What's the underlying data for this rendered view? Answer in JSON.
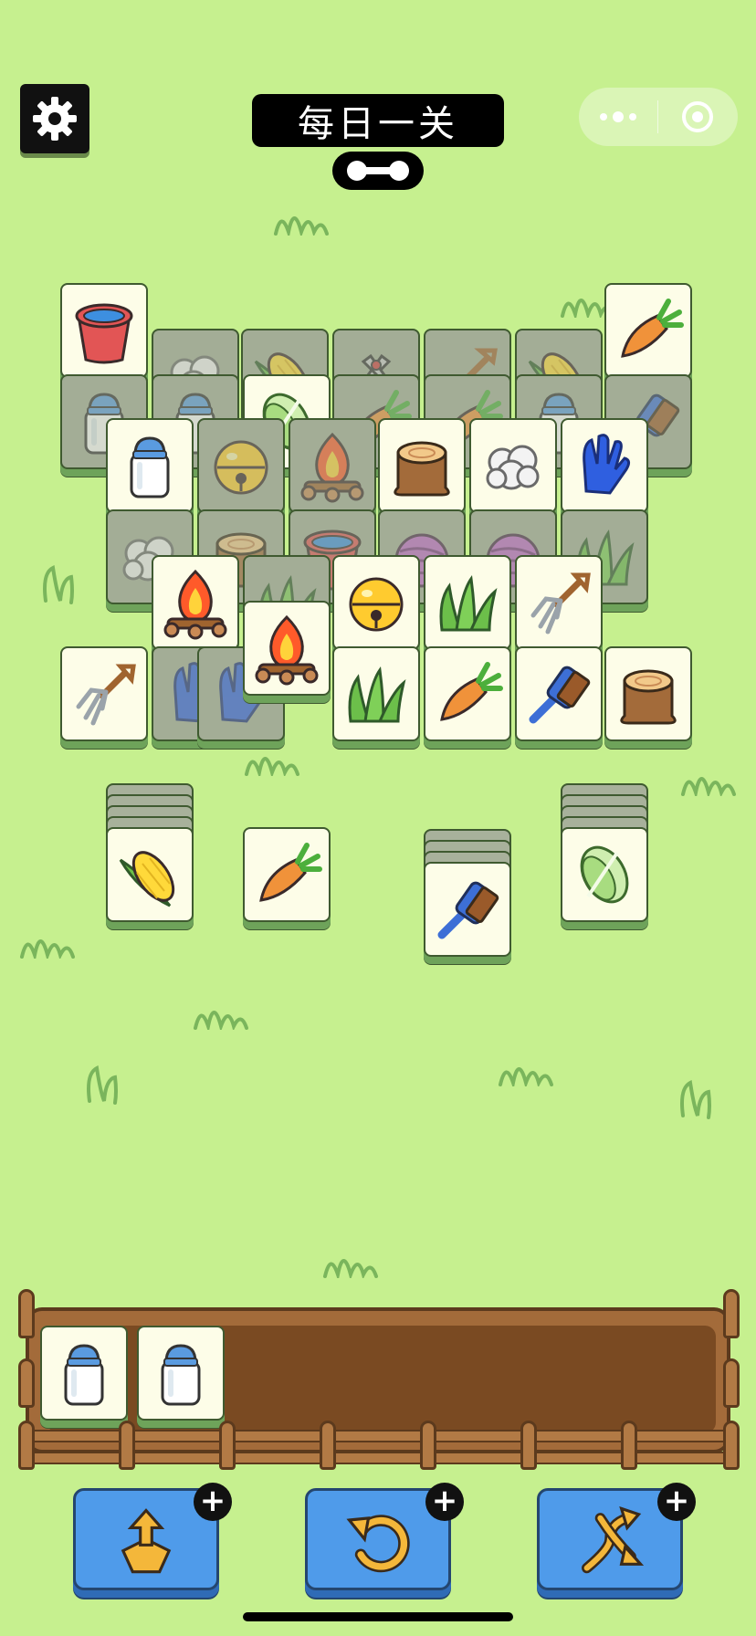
{
  "header": {
    "title": "每日一关",
    "settings_icon": "gear-icon",
    "menu_icon": "more-dots-icon",
    "close_icon": "target-circle-icon"
  },
  "colors": {
    "background": "#c6f08f",
    "tile_face": "#fdfde8",
    "tile_covered": "#a3ad96",
    "tray_wood": "#a36b3a",
    "button_blue": "#4f9bea"
  },
  "board": {
    "tiles": [
      {
        "item": "bucket",
        "state": "free"
      },
      {
        "item": "carrot",
        "state": "free"
      },
      {
        "item": "wool",
        "state": "covered"
      },
      {
        "item": "corn",
        "state": "covered"
      },
      {
        "item": "shears",
        "state": "covered"
      },
      {
        "item": "shovel",
        "state": "covered"
      },
      {
        "item": "corn",
        "state": "covered"
      },
      {
        "item": "milk-jar",
        "state": "covered"
      },
      {
        "item": "milk-jar",
        "state": "covered"
      },
      {
        "item": "carrot",
        "state": "covered"
      },
      {
        "item": "carrot",
        "state": "covered"
      },
      {
        "item": "milk-jar",
        "state": "covered"
      },
      {
        "item": "brush",
        "state": "covered"
      },
      {
        "item": "cabbage",
        "state": "free"
      },
      {
        "item": "milk-jar",
        "state": "free"
      },
      {
        "item": "bell",
        "state": "covered"
      },
      {
        "item": "campfire",
        "state": "covered"
      },
      {
        "item": "stump",
        "state": "free"
      },
      {
        "item": "wool",
        "state": "free"
      },
      {
        "item": "glove",
        "state": "free"
      },
      {
        "item": "wool",
        "state": "covered"
      },
      {
        "item": "stump",
        "state": "covered"
      },
      {
        "item": "bucket",
        "state": "covered"
      },
      {
        "item": "yarn",
        "state": "covered"
      },
      {
        "item": "yarn",
        "state": "covered"
      },
      {
        "item": "grass",
        "state": "covered"
      },
      {
        "item": "campfire",
        "state": "free"
      },
      {
        "item": "grass",
        "state": "covered"
      },
      {
        "item": "bell",
        "state": "free"
      },
      {
        "item": "grass",
        "state": "free"
      },
      {
        "item": "pitchfork",
        "state": "free"
      },
      {
        "item": "pitchfork",
        "state": "free"
      },
      {
        "item": "glove",
        "state": "covered"
      },
      {
        "item": "glove",
        "state": "covered"
      },
      {
        "item": "campfire",
        "state": "free"
      },
      {
        "item": "grass",
        "state": "free"
      },
      {
        "item": "carrot",
        "state": "free"
      },
      {
        "item": "brush",
        "state": "free"
      },
      {
        "item": "stump",
        "state": "free"
      }
    ],
    "stacks": [
      {
        "top_item": "corn",
        "hidden_count": 4
      },
      {
        "top_item": "carrot",
        "hidden_count": 0
      },
      {
        "top_item": "brush",
        "hidden_count": 3
      },
      {
        "top_item": "cabbage",
        "hidden_count": 4
      }
    ]
  },
  "tray": {
    "capacity": 7,
    "slots": [
      "milk-jar",
      "milk-jar"
    ]
  },
  "powerups": [
    {
      "name": "move-out",
      "icon": "tiles-up-arrow-icon",
      "plus": "+"
    },
    {
      "name": "undo",
      "icon": "undo-arrow-icon",
      "plus": "+"
    },
    {
      "name": "shuffle",
      "icon": "shuffle-arrows-icon",
      "plus": "+"
    }
  ]
}
